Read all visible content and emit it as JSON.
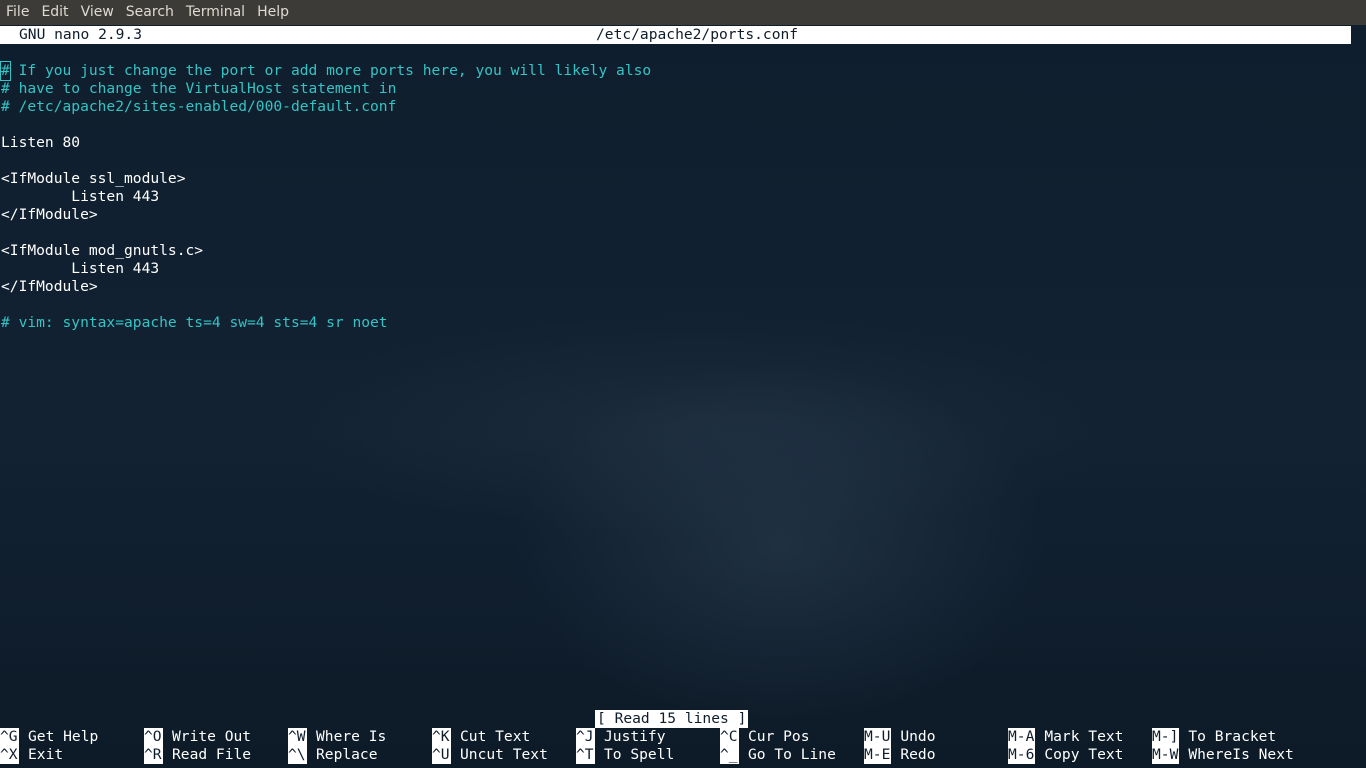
{
  "menubar": {
    "items": [
      "File",
      "Edit",
      "View",
      "Search",
      "Terminal",
      "Help"
    ]
  },
  "nano": {
    "version": "GNU nano 2.9.3",
    "filename": "/etc/apache2/ports.conf",
    "status": "[ Read 15 lines ]"
  },
  "file": {
    "lines": [
      {
        "text": "# If you just change the port or add more ports here, you will likely also",
        "comment": true,
        "cursor": true
      },
      {
        "text": "# have to change the VirtualHost statement in",
        "comment": true
      },
      {
        "text": "# /etc/apache2/sites-enabled/000-default.conf",
        "comment": true
      },
      {
        "text": "",
        "comment": false
      },
      {
        "text": "Listen 80",
        "comment": false
      },
      {
        "text": "",
        "comment": false
      },
      {
        "text": "<IfModule ssl_module>",
        "comment": false
      },
      {
        "text": "        Listen 443",
        "comment": false
      },
      {
        "text": "</IfModule>",
        "comment": false
      },
      {
        "text": "",
        "comment": false
      },
      {
        "text": "<IfModule mod_gnutls.c>",
        "comment": false
      },
      {
        "text": "        Listen 443",
        "comment": false
      },
      {
        "text": "</IfModule>",
        "comment": false
      },
      {
        "text": "",
        "comment": false
      },
      {
        "text": "# vim: syntax=apache ts=4 sw=4 sts=4 sr noet",
        "comment": true
      }
    ]
  },
  "shortcuts": {
    "row1": [
      {
        "key": "^G",
        "label": "Get Help"
      },
      {
        "key": "^O",
        "label": "Write Out"
      },
      {
        "key": "^W",
        "label": "Where Is"
      },
      {
        "key": "^K",
        "label": "Cut Text"
      },
      {
        "key": "^J",
        "label": "Justify"
      },
      {
        "key": "^C",
        "label": "Cur Pos"
      },
      {
        "key": "M-U",
        "label": "Undo"
      },
      {
        "key": "M-A",
        "label": "Mark Text"
      },
      {
        "key": "M-]",
        "label": "To Bracket"
      }
    ],
    "row2": [
      {
        "key": "^X",
        "label": "Exit"
      },
      {
        "key": "^R",
        "label": "Read File"
      },
      {
        "key": "^\\",
        "label": "Replace"
      },
      {
        "key": "^U",
        "label": "Uncut Text"
      },
      {
        "key": "^T",
        "label": "To Spell"
      },
      {
        "key": "^_",
        "label": "Go To Line"
      },
      {
        "key": "M-E",
        "label": "Redo"
      },
      {
        "key": "M-6",
        "label": "Copy Text"
      },
      {
        "key": "M-W",
        "label": "WhereIs Next"
      }
    ]
  },
  "colors": {
    "background": "#0f1d2b",
    "comment": "#34c4c4",
    "text": "#ffffff",
    "menubar": "#3c3b37"
  }
}
